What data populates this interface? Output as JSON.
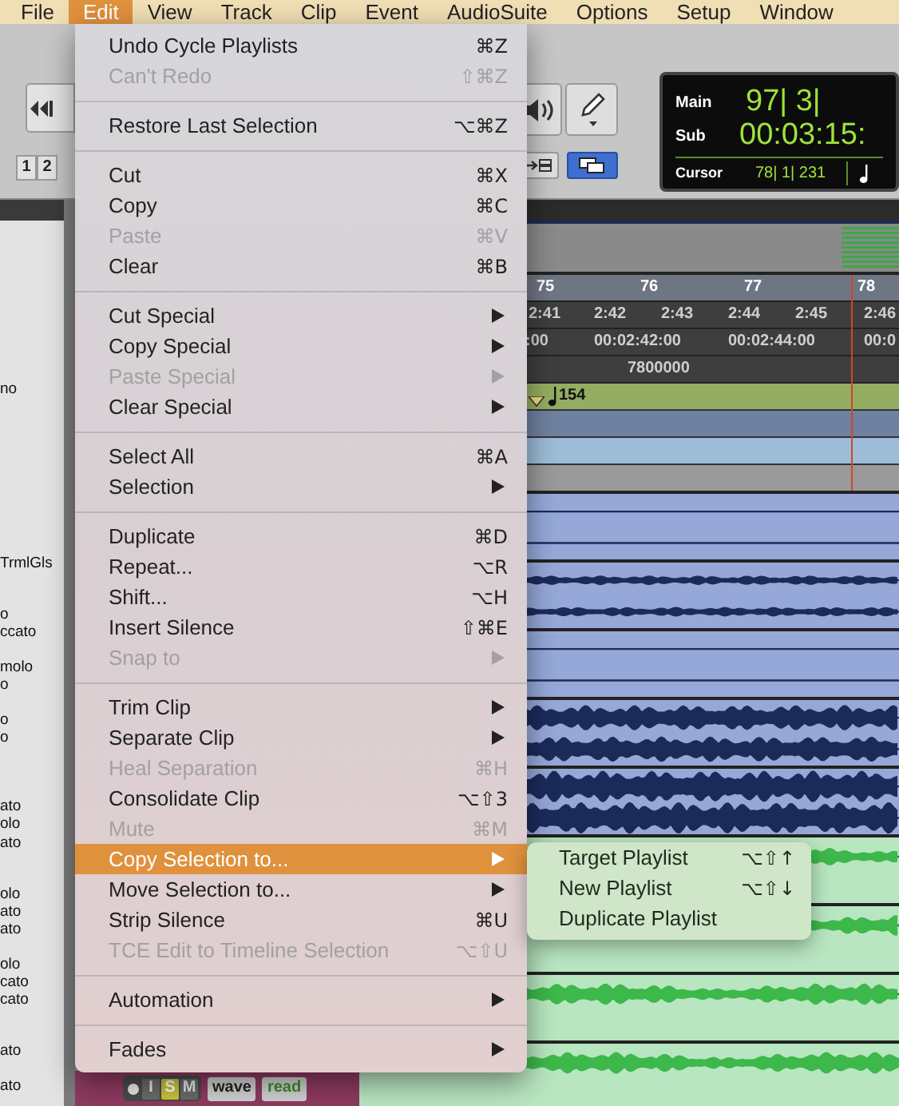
{
  "menu_bar": {
    "items": [
      {
        "label": "File",
        "selected": false
      },
      {
        "label": "Edit",
        "selected": true
      },
      {
        "label": "View",
        "selected": false
      },
      {
        "label": "Track",
        "selected": false
      },
      {
        "label": "Clip",
        "selected": false
      },
      {
        "label": "Event",
        "selected": false
      },
      {
        "label": "AudioSuite",
        "selected": false
      },
      {
        "label": "Options",
        "selected": false
      },
      {
        "label": "Setup",
        "selected": false
      },
      {
        "label": "Window",
        "selected": false
      }
    ]
  },
  "toolbar": {
    "zoom_presets": [
      "1",
      "2"
    ]
  },
  "counter": {
    "main_label": "Main",
    "main_value": "97| 3|",
    "sub_label": "Sub",
    "sub_value": "00:03:15:",
    "cursor_label": "Cursor",
    "cursor_value": "78| 1| 231"
  },
  "track_names": [
    "no",
    "TrmlGls",
    "o",
    "ccato",
    "molo",
    "o",
    "o",
    "o",
    "ato",
    "olo",
    "ato",
    "olo",
    "ato",
    "ato",
    "olo",
    "cato",
    "cato",
    "ato",
    "ato"
  ],
  "rulers": {
    "bars": [
      "75",
      "76",
      "77",
      "78"
    ],
    "min_secs": [
      "2:41",
      "2:42",
      "2:43",
      "2:44",
      "2:45",
      "2:46"
    ],
    "timecode": [
      ":00",
      "00:02:42:00",
      "00:02:44:00",
      "00:0"
    ],
    "samples": [
      "7800000"
    ],
    "tempo": "154"
  },
  "edit_menu": {
    "items": [
      {
        "kind": "item",
        "label": "Undo Cycle Playlists",
        "shortcut": "⌘Z",
        "disabled": false,
        "selected": false,
        "submenu": false
      },
      {
        "kind": "item",
        "label": "Can't Redo",
        "shortcut": "⇧⌘Z",
        "disabled": true,
        "selected": false,
        "submenu": false
      },
      {
        "kind": "separator"
      },
      {
        "kind": "item",
        "label": "Restore Last Selection",
        "shortcut": "⌥⌘Z",
        "disabled": false,
        "selected": false,
        "submenu": false
      },
      {
        "kind": "separator"
      },
      {
        "kind": "item",
        "label": "Cut",
        "shortcut": "⌘X",
        "disabled": false,
        "selected": false,
        "submenu": false
      },
      {
        "kind": "item",
        "label": "Copy",
        "shortcut": "⌘C",
        "disabled": false,
        "selected": false,
        "submenu": false
      },
      {
        "kind": "item",
        "label": "Paste",
        "shortcut": "⌘V",
        "disabled": true,
        "selected": false,
        "submenu": false
      },
      {
        "kind": "item",
        "label": "Clear",
        "shortcut": "⌘B",
        "disabled": false,
        "selected": false,
        "submenu": false
      },
      {
        "kind": "separator"
      },
      {
        "kind": "item",
        "label": "Cut Special",
        "disabled": false,
        "selected": false,
        "submenu": true
      },
      {
        "kind": "item",
        "label": "Copy Special",
        "disabled": false,
        "selected": false,
        "submenu": true
      },
      {
        "kind": "item",
        "label": "Paste Special",
        "disabled": true,
        "selected": false,
        "submenu": true
      },
      {
        "kind": "item",
        "label": "Clear Special",
        "disabled": false,
        "selected": false,
        "submenu": true
      },
      {
        "kind": "separator"
      },
      {
        "kind": "item",
        "label": "Select All",
        "shortcut": "⌘A",
        "disabled": false,
        "selected": false,
        "submenu": false
      },
      {
        "kind": "item",
        "label": "Selection",
        "disabled": false,
        "selected": false,
        "submenu": true
      },
      {
        "kind": "separator"
      },
      {
        "kind": "item",
        "label": "Duplicate",
        "shortcut": "⌘D",
        "disabled": false,
        "selected": false,
        "submenu": false
      },
      {
        "kind": "item",
        "label": "Repeat...",
        "shortcut": "⌥R",
        "disabled": false,
        "selected": false,
        "submenu": false
      },
      {
        "kind": "item",
        "label": "Shift...",
        "shortcut": "⌥H",
        "disabled": false,
        "selected": false,
        "submenu": false
      },
      {
        "kind": "item",
        "label": "Insert Silence",
        "shortcut": "⇧⌘E",
        "disabled": false,
        "selected": false,
        "submenu": false
      },
      {
        "kind": "item",
        "label": "Snap to",
        "disabled": true,
        "selected": false,
        "submenu": true
      },
      {
        "kind": "separator"
      },
      {
        "kind": "item",
        "label": "Trim Clip",
        "disabled": false,
        "selected": false,
        "submenu": true
      },
      {
        "kind": "item",
        "label": "Separate Clip",
        "disabled": false,
        "selected": false,
        "submenu": true
      },
      {
        "kind": "item",
        "label": "Heal Separation",
        "shortcut": "⌘H",
        "disabled": true,
        "selected": false,
        "submenu": false
      },
      {
        "kind": "item",
        "label": "Consolidate Clip",
        "shortcut": "⌥⇧3",
        "disabled": false,
        "selected": false,
        "submenu": false
      },
      {
        "kind": "item",
        "label": "Mute",
        "shortcut": "⌘M",
        "disabled": true,
        "selected": false,
        "submenu": false
      },
      {
        "kind": "item",
        "label": "Copy Selection to...",
        "disabled": false,
        "selected": true,
        "submenu": true
      },
      {
        "kind": "item",
        "label": "Move Selection to...",
        "disabled": false,
        "selected": false,
        "submenu": true
      },
      {
        "kind": "item",
        "label": "Strip Silence",
        "shortcut": "⌘U",
        "disabled": false,
        "selected": false,
        "submenu": false
      },
      {
        "kind": "item",
        "label": "TCE Edit to Timeline Selection",
        "shortcut": "⌥⇧U",
        "disabled": true,
        "selected": false,
        "submenu": false
      },
      {
        "kind": "separator"
      },
      {
        "kind": "item",
        "label": "Automation",
        "disabled": false,
        "selected": false,
        "submenu": true
      },
      {
        "kind": "separator"
      },
      {
        "kind": "item",
        "label": "Fades",
        "disabled": false,
        "selected": false,
        "submenu": true
      }
    ]
  },
  "submenu": {
    "items": [
      {
        "label": "Target Playlist",
        "shortcut": "⌥⇧↑"
      },
      {
        "label": "New Playlist",
        "shortcut": "⌥⇧↓"
      },
      {
        "label": "Duplicate Playlist"
      }
    ]
  },
  "track_header": {
    "input": {
      "label": "I",
      "on": false
    },
    "solo": {
      "label": "S",
      "on": true
    },
    "mute": {
      "label": "M",
      "on": false
    },
    "view": "wave",
    "automation": "read"
  }
}
